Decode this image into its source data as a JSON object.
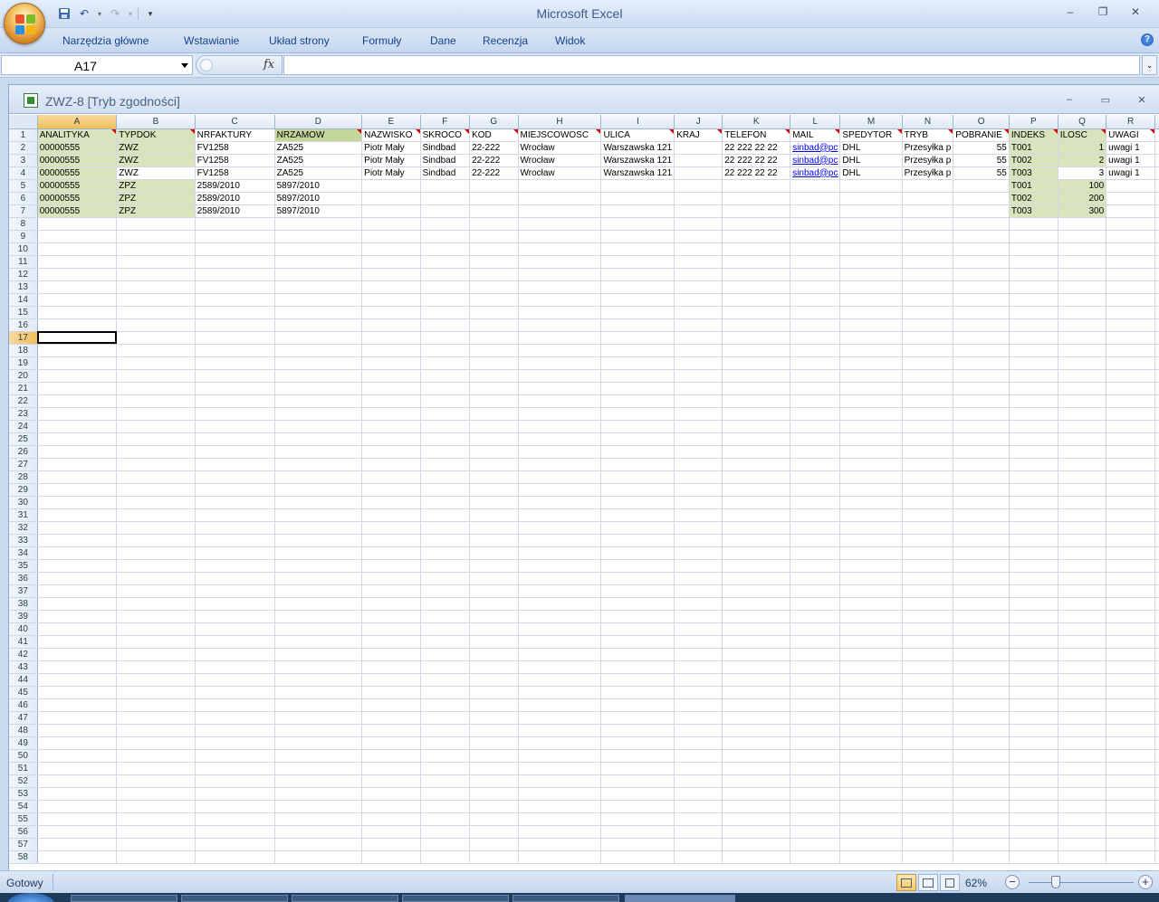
{
  "app": {
    "title": "Microsoft Excel",
    "ribbon_tabs": [
      "Narzędzia główne",
      "Wstawianie",
      "Układ strony",
      "Formuły",
      "Dane",
      "Recenzja",
      "Widok"
    ],
    "help_label": "?"
  },
  "formula_bar": {
    "name_box": "A17",
    "fx_label": "fx",
    "formula": ""
  },
  "workbook": {
    "title": "ZWZ-8  [Tryb zgodności]"
  },
  "sheet": {
    "columns": [
      "A",
      "B",
      "C",
      "D",
      "E",
      "F",
      "G",
      "H",
      "I",
      "J",
      "K",
      "L",
      "M",
      "N",
      "O",
      "P",
      "Q",
      "R"
    ],
    "selected_column": "A",
    "selected_row": 17,
    "row_count": 58,
    "rows": [
      [
        "ANALITYKA",
        "TYPDOK",
        "NRFAKTURY",
        "NRZAMOW",
        "NAZWISKO",
        "SKROCO",
        "KOD",
        "MIEJSCOWOSC",
        "ULICA",
        "KRAJ",
        "TELEFON",
        "MAIL",
        "SPEDYTOR",
        "TRYB",
        "POBRANIE",
        "INDEKS",
        "ILOSC",
        "UWAGI"
      ],
      [
        "00000555",
        "ZWZ",
        "FV1258",
        "ZA525",
        "Piotr Mały",
        "Sindbad",
        "22-222",
        "Wrocław",
        "Warszawska 121",
        "",
        "22 222 22 22",
        "sinbad@pc",
        "DHL",
        "Przesyłka p",
        "55",
        "T001",
        "1",
        "uwagi 1"
      ],
      [
        "00000555",
        "ZWZ",
        "FV1258",
        "ZA525",
        "Piotr Mały",
        "Sindbad",
        "22-222",
        "Wrocław",
        "Warszawska 121",
        "",
        "22 222 22 22",
        "sinbad@pc",
        "DHL",
        "Przesyłka p",
        "55",
        "T002",
        "2",
        "uwagi 1"
      ],
      [
        "00000555",
        "ZWZ",
        "FV1258",
        "ZA525",
        "Piotr Mały",
        "Sindbad",
        "22-222",
        "Wrocław",
        "Warszawska 121",
        "",
        "22 222 22 22",
        "sinbad@pc",
        "DHL",
        "Przesyłka p",
        "55",
        "T003",
        "3",
        "uwagi 1"
      ],
      [
        "00000555",
        "ZPZ",
        "2589/2010",
        "5897/2010",
        "",
        "",
        "",
        "",
        "",
        "",
        "",
        "",
        "",
        "",
        "",
        "T001",
        "100",
        ""
      ],
      [
        "00000555",
        "ZPZ",
        "2589/2010",
        "5897/2010",
        "",
        "",
        "",
        "",
        "",
        "",
        "",
        "",
        "",
        "",
        "",
        "T002",
        "200",
        ""
      ],
      [
        "00000555",
        "ZPZ",
        "2589/2010",
        "5897/2010",
        "",
        "",
        "",
        "",
        "",
        "",
        "",
        "",
        "",
        "",
        "",
        "T003",
        "300",
        ""
      ]
    ]
  },
  "status_bar": {
    "ready": "Gotowy",
    "zoom": "62%"
  }
}
